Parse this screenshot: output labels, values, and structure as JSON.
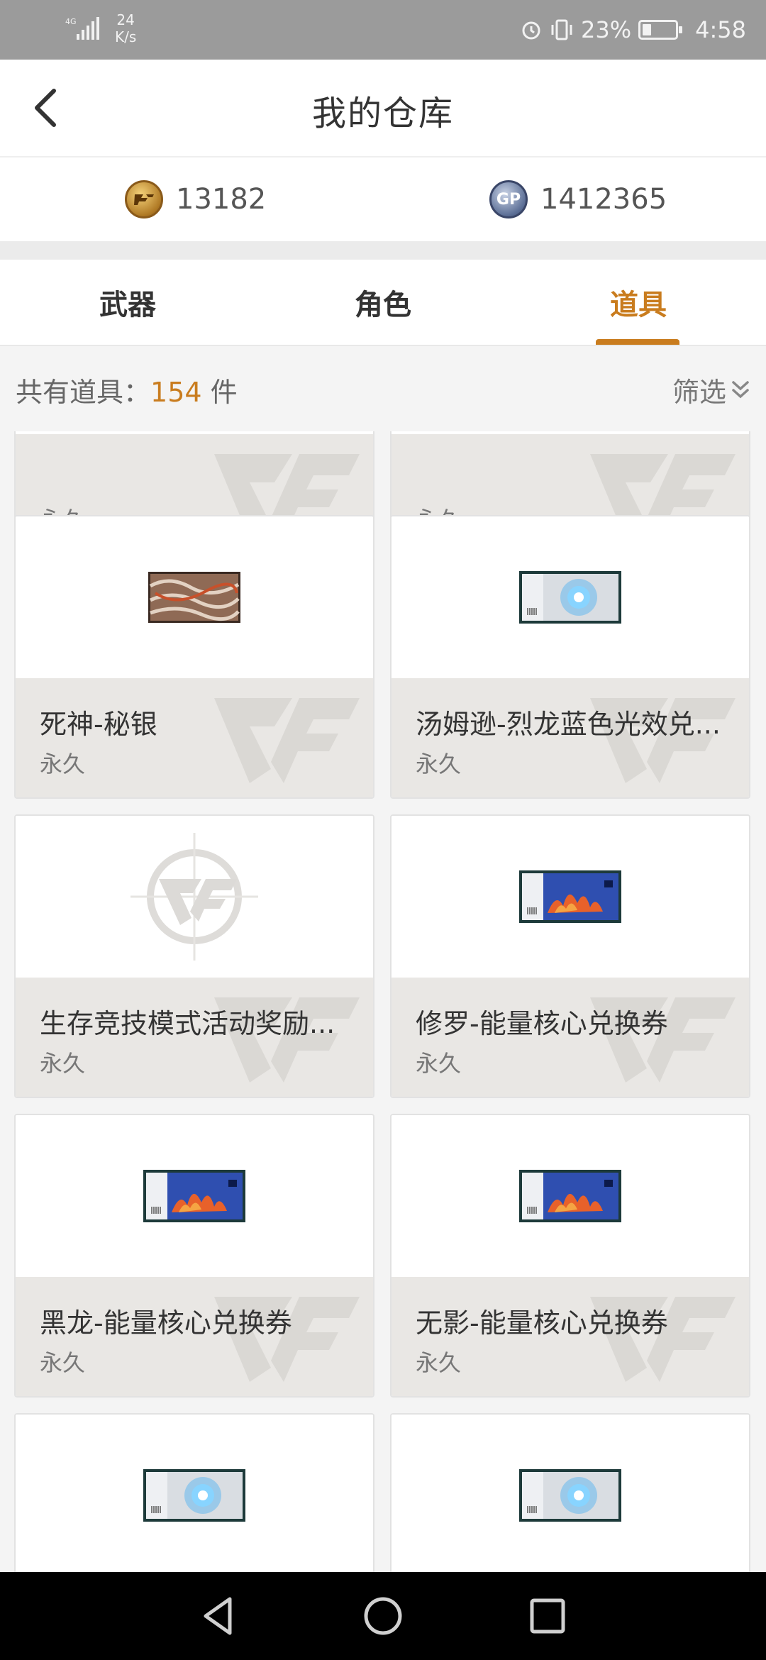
{
  "status_bar": {
    "network": "4G",
    "speed_value": "24",
    "speed_unit": "K/s",
    "battery": "23%",
    "time": "4:58"
  },
  "header": {
    "title": "我的仓库"
  },
  "currency": {
    "cf_points": "13182",
    "gp_points": "1412365",
    "gp_icon_text": "GP"
  },
  "tabs": [
    {
      "label": "武器",
      "active": false
    },
    {
      "label": "角色",
      "active": false
    },
    {
      "label": "道具",
      "active": true
    }
  ],
  "summary": {
    "prefix": "共有道具：",
    "count": "154",
    "suffix": "件",
    "filter_label": "筛选"
  },
  "items": [
    {
      "name": "",
      "duration": "永久",
      "thumb": "none"
    },
    {
      "name": "",
      "duration": "永久",
      "thumb": "none"
    },
    {
      "name": "死神-秘银",
      "duration": "永久",
      "thumb": "weapon-skin-silver"
    },
    {
      "name": "汤姆逊-烈龙蓝色光效兑...",
      "duration": "永久",
      "thumb": "ticket-blue-glow"
    },
    {
      "name": "生存竞技模式活动奖励...",
      "duration": "永久",
      "thumb": "cf-placeholder-logo"
    },
    {
      "name": "修罗-能量核心兑换券",
      "duration": "永久",
      "thumb": "ticket-flame"
    },
    {
      "name": "黑龙-能量核心兑换券",
      "duration": "永久",
      "thumb": "ticket-flame"
    },
    {
      "name": "无影-能量核心兑换券",
      "duration": "永久",
      "thumb": "ticket-flame"
    },
    {
      "name": "",
      "duration": "",
      "thumb": "ticket-blue-glow"
    },
    {
      "name": "",
      "duration": "",
      "thumb": "ticket-blue-glow"
    }
  ],
  "colors": {
    "accent": "#c97c1e",
    "status_bar": "#9b9b9b",
    "card_info_bg": "#e9e7e4"
  }
}
